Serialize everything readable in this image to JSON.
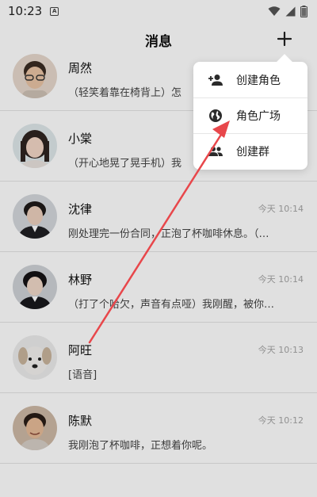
{
  "status_bar": {
    "time": "10:23",
    "notification_letter": "A"
  },
  "header": {
    "title": "消息"
  },
  "chats": [
    {
      "name": "周然",
      "time": "",
      "preview": "（轻笑着靠在椅背上）怎"
    },
    {
      "name": "小棠",
      "time": "",
      "preview": "（开心地晃了晃手机）我"
    },
    {
      "name": "沈律",
      "time": "今天 10:14",
      "preview": "刚处理完一份合同，正泡了杯咖啡休息。（…"
    },
    {
      "name": "林野",
      "time": "今天 10:14",
      "preview": "（打了个哈欠，声音有点哑）我刚醒，被你…"
    },
    {
      "name": "阿旺",
      "time": "今天 10:13",
      "preview": "[语音]"
    },
    {
      "name": "陈默",
      "time": "今天 10:12",
      "preview": "我刚泡了杯咖啡，正想着你呢。"
    }
  ],
  "menu": {
    "items": [
      {
        "label": "创建角色",
        "icon": "person-add-icon"
      },
      {
        "label": "角色广场",
        "icon": "globe-icon"
      },
      {
        "label": "创建群",
        "icon": "group-icon"
      }
    ]
  },
  "colors": {
    "accent_arrow": "#e8474b",
    "time_text": "#a5a5a5"
  }
}
